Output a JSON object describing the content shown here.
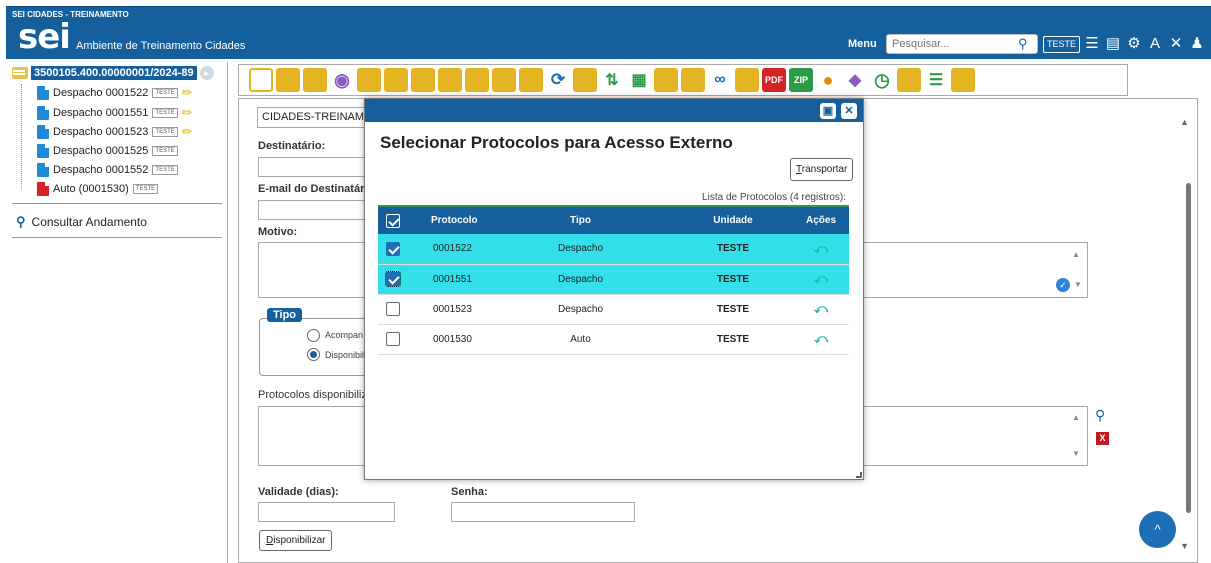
{
  "app": {
    "system_name": "SEI CIDADES - TREINAMENTO",
    "logo": "sei",
    "environment": "Ambiente de Treinamento Cidades",
    "menu_label": "Menu",
    "search_placeholder": "Pesquisar...",
    "unit": "TESTE"
  },
  "tree": {
    "process": "3500105.400.00000001/2024-89",
    "documents": [
      {
        "label": "Despacho 0001522",
        "badge": "TESTE",
        "signed": true
      },
      {
        "label": "Despacho 0001551",
        "badge": "TESTE",
        "signed": true
      },
      {
        "label": "Despacho 0001523",
        "badge": "TESTE",
        "signed": true
      },
      {
        "label": "Despacho 0001525",
        "badge": "TESTE",
        "signed": false
      },
      {
        "label": "Despacho 0001552",
        "badge": "TESTE",
        "signed": false
      },
      {
        "label": "Auto (0001530)",
        "badge": "TESTE",
        "signed": false
      }
    ],
    "consultar": "Consultar Andamento"
  },
  "form": {
    "unit_header": "CIDADES-TREINAMEN",
    "destinatario": "Destinatário:",
    "email": "E-mail do Destinatário:",
    "motivo": "Motivo:",
    "tipo_legend": "Tipo",
    "radio1": "Acompan",
    "radio2": "Disponibil",
    "protocolos": "Protocolos disponibilizad",
    "validade": "Validade (dias):",
    "senha": "Senha:",
    "disponibilizar_pre": "D",
    "disponibilizar_rest": "isponibilizar"
  },
  "modal": {
    "title": "Selecionar Protocolos para Acesso Externo",
    "transport_pre": "T",
    "transport_rest": "ransportar",
    "caption": "Lista de Protocolos (4 registros):",
    "columns": {
      "protocolo": "Protocolo",
      "tipo": "Tipo",
      "unidade": "Unidade",
      "acoes": "Ações"
    },
    "rows": [
      {
        "protocolo": "0001522",
        "tipo": "Despacho",
        "unidade": "TESTE",
        "checked": true
      },
      {
        "protocolo": "0001551",
        "tipo": "Despacho",
        "unidade": "TESTE",
        "checked": true
      },
      {
        "protocolo": "0001523",
        "tipo": "Despacho",
        "unidade": "TESTE",
        "checked": false
      },
      {
        "protocolo": "0001530",
        "tipo": "Auto",
        "unidade": "TESTE",
        "checked": false
      }
    ]
  },
  "colors": {
    "brand": "#155f9c",
    "selected_row": "#33e0ea",
    "action_arrow": "#17b8a8"
  }
}
